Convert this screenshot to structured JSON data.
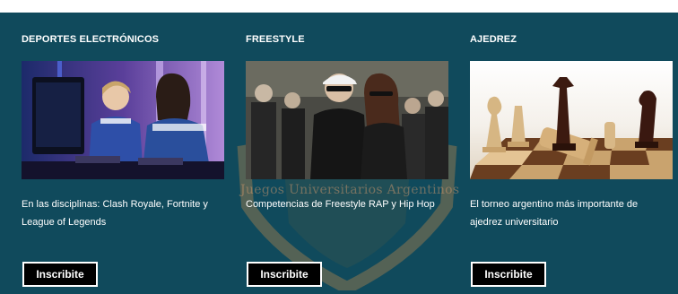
{
  "watermark": {
    "text": "Juegos Universitarios Argentinos"
  },
  "cards": [
    {
      "title": "DEPORTES ELECTRÓNICOS",
      "image": "esports-players-photo",
      "description": "En las disciplinas: Clash Royale, Fortnite y League of Legends",
      "button": "Inscribite"
    },
    {
      "title": "FREESTYLE",
      "image": "freestyle-rappers-photo",
      "description": "Competencias de Freestyle RAP y Hip Hop",
      "button": "Inscribite"
    },
    {
      "title": "AJEDREZ",
      "image": "chess-pieces-photo",
      "description": "El torneo argentino más importante de ajedrez universitario",
      "button": "Inscribite"
    }
  ],
  "colors": {
    "section_background": "#104a5c",
    "button_background": "#000000",
    "text": "#ffffff"
  }
}
